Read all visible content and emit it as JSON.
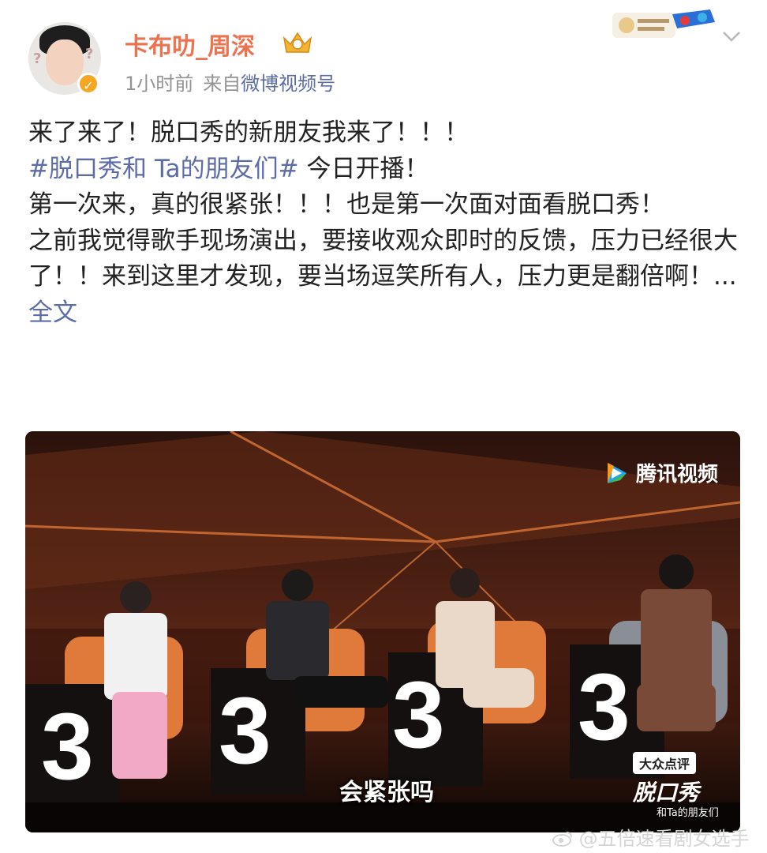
{
  "post": {
    "author": "卡布叻_周深",
    "time": "1小时前",
    "source_prefix": "来自",
    "source_name": "微博视频号",
    "line1": "来了来了！脱口秀的新朋友我来了！！！",
    "hashtag": "#脱口秀和 Ta的朋友们#",
    "line2_rest": " 今日开播！",
    "line3": "第一次来，真的很紧张！！！也是第一次面对面看脱口秀！",
    "line4": "之前我觉得歌手现场演出，要接收观众即时的反馈，压力已经很大了！！来到这里才发现，要当场逗笑所有人，压力更是翻倍啊！...",
    "full_text_link": " 全文"
  },
  "video": {
    "platform": "腾讯视频",
    "subtitle": "会紧张吗",
    "sponsor": "大众点评",
    "show_title": "脱口秀",
    "show_sub": "和Ta的朋友们"
  },
  "watermark": "@五倍速看剧女选手",
  "colors": {
    "username": "#eb7350",
    "link": "#5d6ca6",
    "meta": "#939393"
  },
  "icons": [
    "crown-badge-icon",
    "verified-icon",
    "chevron-down-icon",
    "tencent-video-icon",
    "weibo-icon"
  ]
}
